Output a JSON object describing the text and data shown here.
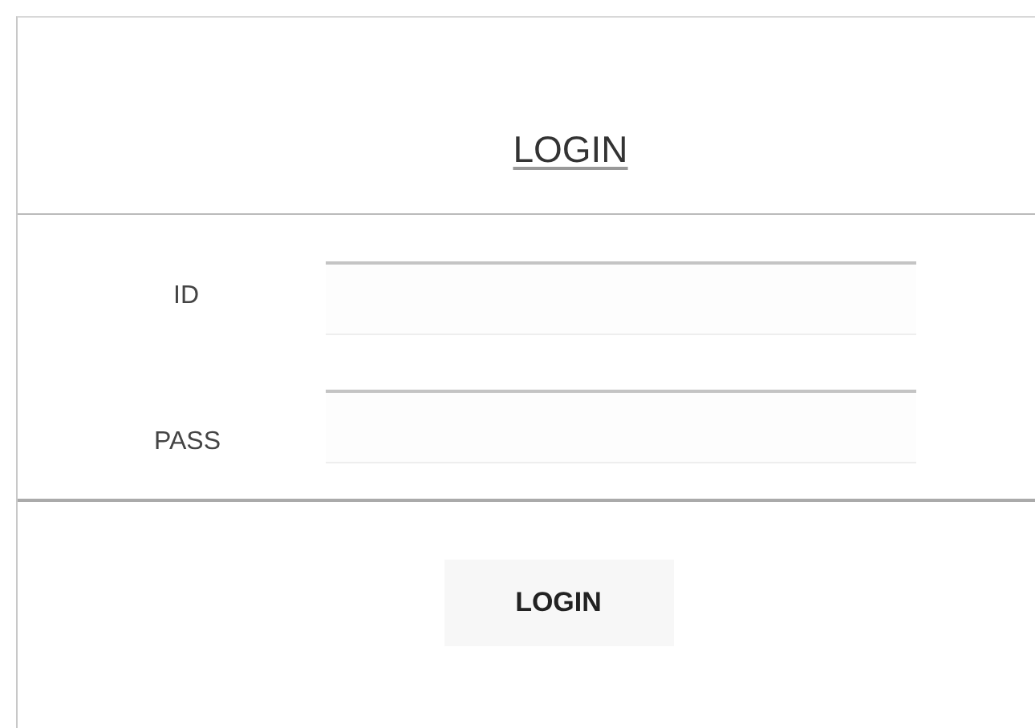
{
  "title": "LOGIN",
  "fields": [
    {
      "label": "ID"
    },
    {
      "label": "PASS"
    }
  ],
  "button": "LOGIN"
}
